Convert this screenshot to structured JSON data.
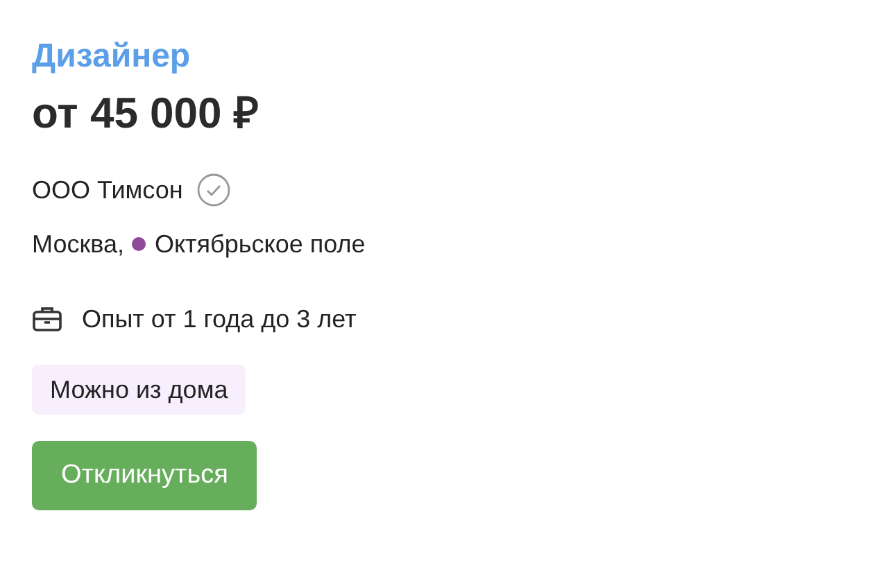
{
  "vacancy": {
    "title": "Дизайнер",
    "salary": "от 45 000 ₽",
    "company": {
      "name": "ООО Тимсон",
      "verified": true
    },
    "city": "Москва,",
    "metro": {
      "name": "Октябрьское поле",
      "color": "#8e4a96"
    },
    "experience": "Опыт от 1 года до 3 лет",
    "tags": [
      "Можно из дома"
    ],
    "button": "Откликнуться"
  }
}
